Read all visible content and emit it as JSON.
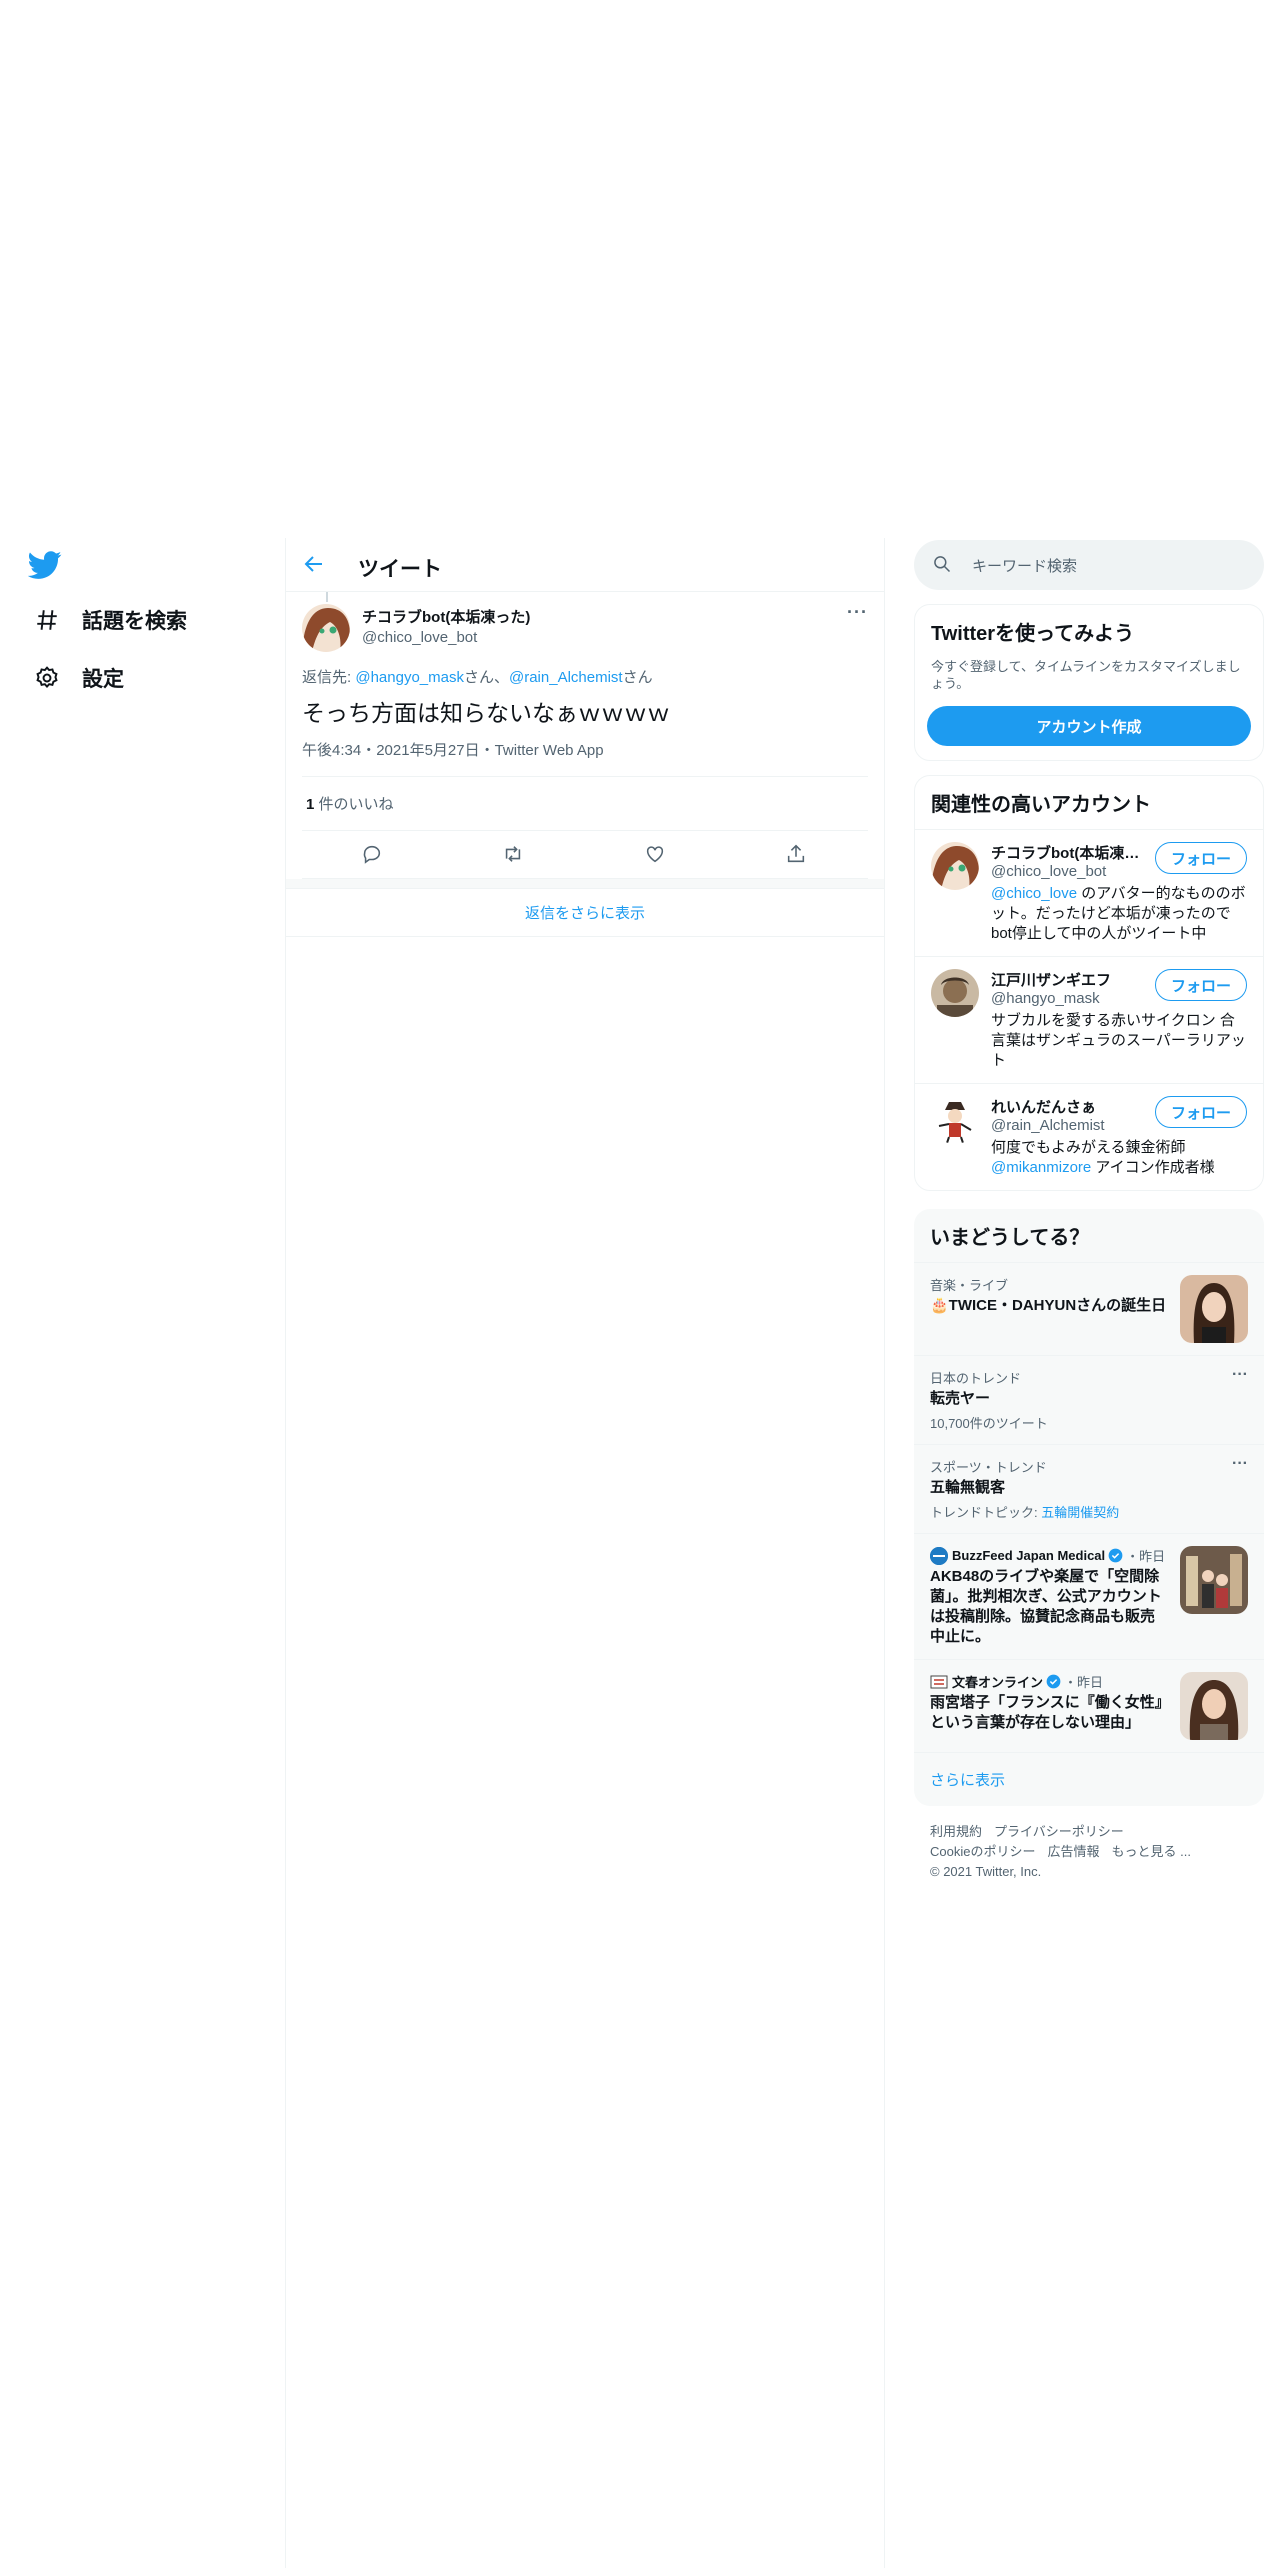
{
  "nav": {
    "items": [
      {
        "label": "話題を検索",
        "icon": "hashtag-icon"
      },
      {
        "label": "設定",
        "icon": "gear-icon"
      }
    ]
  },
  "header": {
    "title": "ツイート"
  },
  "tweet": {
    "name": "チコラブbot(本垢凍った)",
    "handle": "@chico_love_bot",
    "reply_prefix": "返信先: ",
    "reply_user1": "@hangyo_mask",
    "reply_sep": "さん、",
    "reply_user2": "@rain_Alchemist",
    "reply_suffix": "さん",
    "text": "そっち方面は知らないなぁｗｗｗｗ",
    "meta": "午後4:34・2021年5月27日・Twitter Web App",
    "like_count": "1",
    "like_label": " 件のいいね",
    "more": "···"
  },
  "show_more_replies": "返信をさらに表示",
  "search": {
    "placeholder": "キーワード検索"
  },
  "signup": {
    "title": "Twitterを使ってみよう",
    "subtitle": "今すぐ登録して、タイムラインをカスタマイズしましょう。",
    "button": "アカウント作成"
  },
  "related": {
    "title": "関連性の高いアカウント",
    "follow_label": "フォロー",
    "accounts": [
      {
        "name": "チコラブbot(本垢凍った)",
        "handle": "@chico_love_bot",
        "bio_link": "@chico_love",
        "bio": " のアバター的なもののボット。だったけど本垢が凍ったのでbot停止して中の人がツイート中"
      },
      {
        "name": "江戸川ザンギエフ",
        "handle": "@hangyo_mask",
        "bio_link": "",
        "bio": "サブカルを愛する赤いサイクロン 合言葉はザンギュラのスーパーラリアット"
      },
      {
        "name": "れいんだんさぁ",
        "handle": "@rain_Alchemist",
        "bio_link": "",
        "bio": "何度でもよみがえる錬金術師",
        "bio2_link": "@mikanmizore",
        "bio2": " アイコン作成者様"
      }
    ]
  },
  "trends": {
    "title": "いまどうしてる？",
    "items": [
      {
        "category": "音楽・ライブ",
        "title": "🎂TWICE・DAHYUNさんの誕生日"
      },
      {
        "category": "日本のトレンド",
        "title": "転売ヤー",
        "sub": "10,700件のツイート"
      },
      {
        "category": "スポーツ・トレンド",
        "title": "五輪無観客",
        "sub_prefix": "トレンドトピック: ",
        "sub_link": "五輪開催契約"
      },
      {
        "source": "BuzzFeed Japan Medical",
        "time": "・昨日",
        "title": "AKB48のライブや楽屋で「空間除菌」。批判相次ぎ、公式アカウントは投稿削除。協賛記念商品も販売中止に。"
      },
      {
        "source": "文春オンライン",
        "time": "・昨日",
        "title": "雨宮塔子「フランスに『働く女性』という言葉が存在しない理由」"
      }
    ],
    "dots": "···",
    "show_more": "さらに表示"
  },
  "footer": {
    "links": [
      "利用規約",
      "プライバシーポリシー",
      "Cookieのポリシー",
      "広告情報",
      "もっと見る ..."
    ],
    "copyright": "© 2021 Twitter, Inc."
  },
  "colors": {
    "accent": "#1d9bf0",
    "text": "#0f1419",
    "muted": "#536471"
  }
}
